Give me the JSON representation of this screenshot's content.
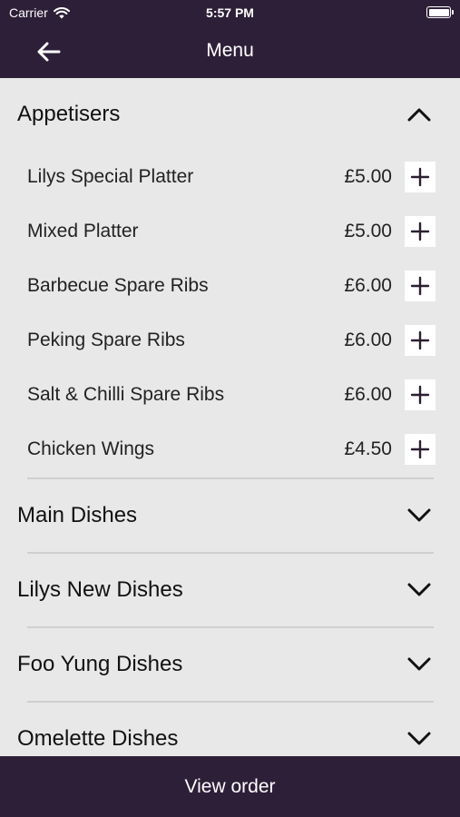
{
  "status_bar": {
    "carrier": "Carrier",
    "time": "5:57 PM"
  },
  "nav": {
    "title": "Menu"
  },
  "sections": [
    {
      "title": "Appetisers",
      "expanded": true,
      "items": [
        {
          "name": "Lilys Special Platter",
          "price": "£5.00"
        },
        {
          "name": "Mixed Platter",
          "price": "£5.00"
        },
        {
          "name": "Barbecue Spare Ribs",
          "price": "£6.00"
        },
        {
          "name": "Peking Spare Ribs",
          "price": "£6.00"
        },
        {
          "name": "Salt & Chilli Spare Ribs",
          "price": "£6.00"
        },
        {
          "name": "Chicken Wings",
          "price": "£4.50"
        }
      ]
    },
    {
      "title": "Main Dishes",
      "expanded": false
    },
    {
      "title": "Lilys New Dishes",
      "expanded": false
    },
    {
      "title": "Foo Yung Dishes",
      "expanded": false
    },
    {
      "title": "Omelette Dishes",
      "expanded": false
    }
  ],
  "footer": {
    "label": "View order"
  },
  "colors": {
    "bar": "#2e1f38",
    "background": "#e8e8e8"
  }
}
